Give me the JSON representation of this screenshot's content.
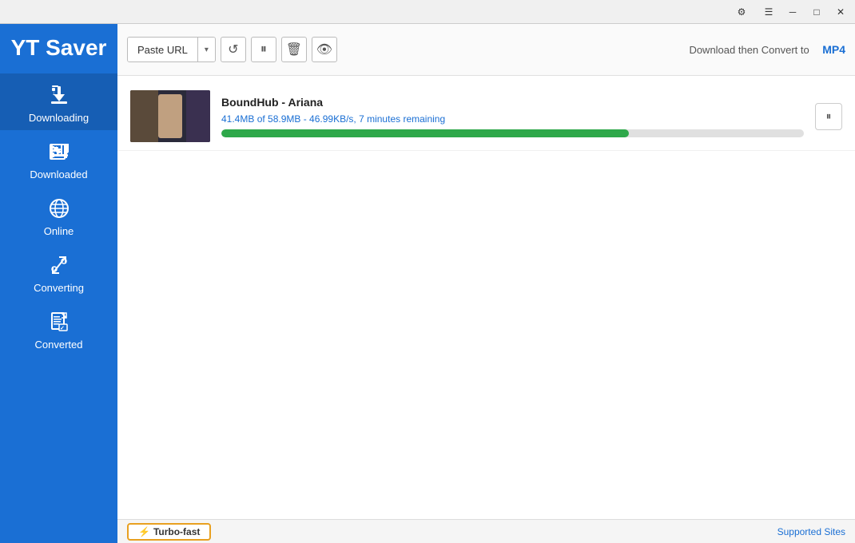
{
  "titlebar": {
    "gear_icon": "⚙",
    "menu_icon": "☰",
    "minimize_icon": "─",
    "maximize_icon": "□",
    "close_icon": "✕"
  },
  "sidebar": {
    "app_title": "YT Saver",
    "nav_items": [
      {
        "id": "downloading",
        "label": "Downloading",
        "active": true
      },
      {
        "id": "downloaded",
        "label": "Downloaded",
        "active": false
      },
      {
        "id": "online",
        "label": "Online",
        "active": false
      },
      {
        "id": "converting",
        "label": "Converting",
        "active": false
      },
      {
        "id": "converted",
        "label": "Converted",
        "active": false
      }
    ]
  },
  "toolbar": {
    "paste_url_label": "Paste URL",
    "dropdown_arrow": "▾",
    "convert_label": "Download then Convert to",
    "convert_format": "MP4"
  },
  "download_items": [
    {
      "id": "item1",
      "title": "BoundHub - Ariana",
      "status": "41.4MB of 58.9MB  -   46.99KB/s, 7 minutes remaining",
      "progress": 70
    }
  ],
  "footer": {
    "turbo_icon": "⚡",
    "turbo_label": "Turbo-fast",
    "supported_sites": "Supported Sites"
  }
}
